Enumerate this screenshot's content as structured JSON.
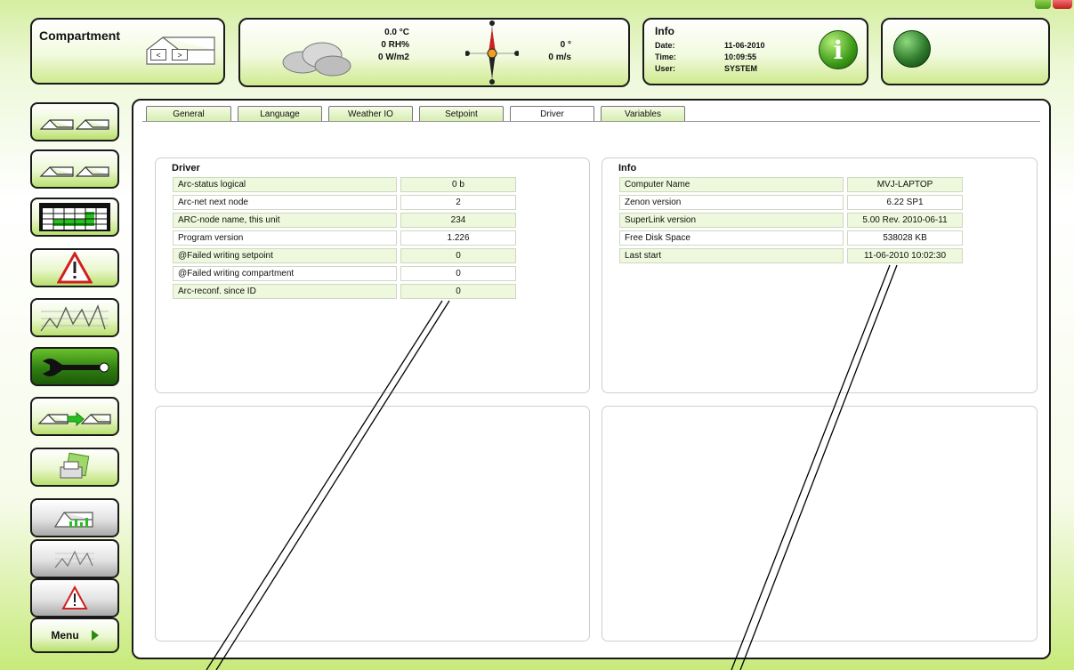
{
  "header": {
    "compartment_title": "Compartment",
    "nav_prev": "<",
    "nav_next": ">",
    "weather": {
      "temperature": "0.0 °C",
      "humidity": "0 RH%",
      "radiation": "0 W/m2",
      "wind_direction": "0 °",
      "wind_speed": "0 m/s"
    },
    "info": {
      "title": "Info",
      "date_label": "Date:",
      "date_value": "11-06-2010",
      "time_label": "Time:",
      "time_value": "10:09:55",
      "user_label": "User:",
      "user_value": "SYSTEM",
      "info_glyph": "i"
    }
  },
  "sidebar": {
    "buttons": [
      {
        "icon": "compartments-icon"
      },
      {
        "icon": "compartments-overview-icon"
      },
      {
        "icon": "table-grid-icon"
      },
      {
        "icon": "alarm-warning-icon"
      },
      {
        "icon": "graph-icon"
      },
      {
        "icon": "wrench-settings-icon"
      },
      {
        "icon": "compartment-copy-icon"
      },
      {
        "icon": "print-icon"
      },
      {
        "icon": "greenhouse-chart-icon"
      },
      {
        "icon": "graph-grey-icon"
      },
      {
        "icon": "alarm-grey-icon"
      }
    ],
    "menu_label": "Menu"
  },
  "tabs": [
    {
      "label": "General"
    },
    {
      "label": "Language"
    },
    {
      "label": "Weather IO"
    },
    {
      "label": "Setpoint"
    },
    {
      "label": "Driver",
      "active": true
    },
    {
      "label": "Variables"
    }
  ],
  "driver": {
    "title": "Driver",
    "rows": [
      {
        "label": "Arc-status logical",
        "value": "0 b"
      },
      {
        "label": "Arc-net next node",
        "value": "2"
      },
      {
        "label": "ARC-node name, this unit",
        "value": "234"
      },
      {
        "label": "Program version",
        "value": "1.226"
      },
      {
        "label": "@Failed writing setpoint",
        "value": "0"
      },
      {
        "label": "@Failed writing compartment",
        "value": "0"
      },
      {
        "label": "Arc-reconf. since ID",
        "value": "0"
      }
    ]
  },
  "info": {
    "title": "Info",
    "rows": [
      {
        "label": "Computer Name",
        "value": "MVJ-LAPTOP"
      },
      {
        "label": "Zenon version",
        "value": "6.22 SP1"
      },
      {
        "label": "SuperLink version",
        "value": "5.00 Rev. 2010-06-11"
      },
      {
        "label": "Free Disk Space",
        "value": "538028 KB"
      },
      {
        "label": "Last start",
        "value": "11-06-2010 10:02:30"
      }
    ]
  },
  "colors": {
    "accent_green": "#b9e06d",
    "field_green": "#edf8dc",
    "active_button": "#2f7f11"
  }
}
